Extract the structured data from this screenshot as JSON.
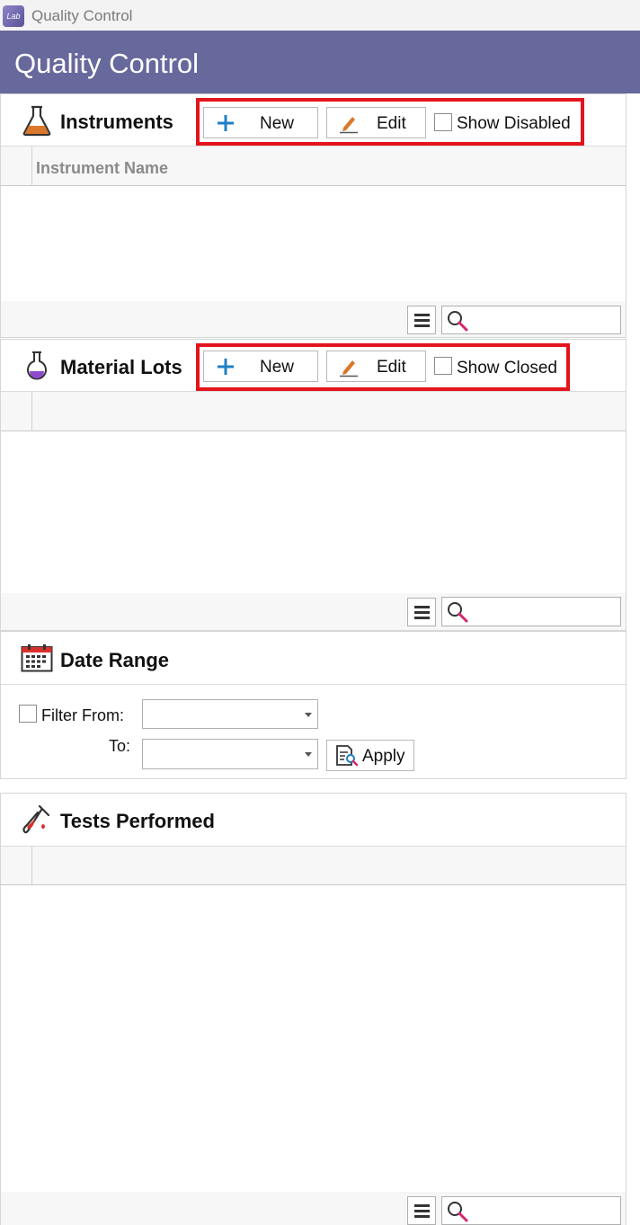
{
  "window": {
    "title": "Quality Control",
    "icon_text": "Lab"
  },
  "header": {
    "title": "Quality Control"
  },
  "instruments": {
    "title": "Instruments",
    "new_label": "New",
    "edit_label": "Edit",
    "checkbox_label": "Show Disabled",
    "checkbox_checked": false,
    "column_header": "Instrument Name",
    "search_value": ""
  },
  "material_lots": {
    "title": "Material Lots",
    "new_label": "New",
    "edit_label": "Edit",
    "checkbox_label": "Show Closed",
    "checkbox_checked": false,
    "column_header": "",
    "search_value": ""
  },
  "date_range": {
    "title": "Date Range",
    "filter_label": "Filter From:",
    "filter_checked": false,
    "from_value": "",
    "to_label": "To:",
    "to_value": "",
    "apply_label": "Apply"
  },
  "tests": {
    "title": "Tests Performed",
    "column_header": "",
    "search_value": ""
  },
  "colors": {
    "header_bg": "#67689b",
    "highlight": "#e2141c",
    "plus_icon": "#1f7fc4",
    "pencil_icon": "#d9782a"
  }
}
